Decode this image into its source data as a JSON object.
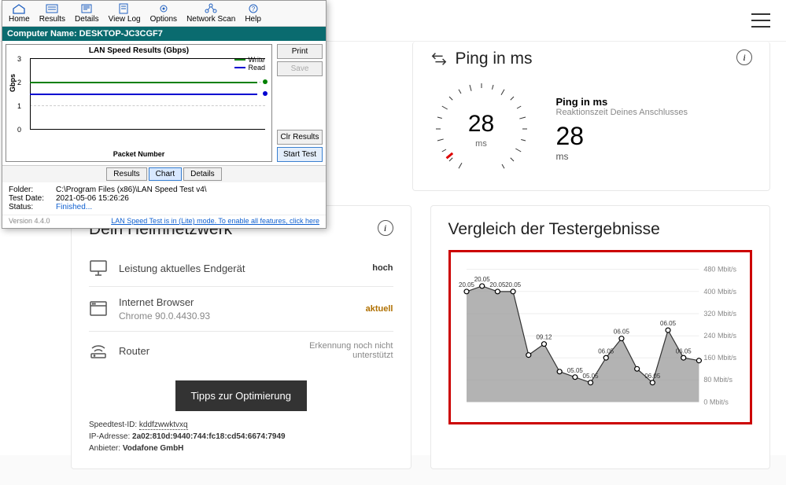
{
  "lan": {
    "menu": {
      "home": "Home",
      "results": "Results",
      "details": "Details",
      "viewlog": "View Log",
      "options": "Options",
      "netscan": "Network Scan",
      "help": "Help"
    },
    "titlebar": "Computer Name: DESKTOP-JC3CGF7",
    "chart": {
      "title": "LAN Speed Results (Gbps)",
      "ylabel": "Gbps",
      "xlabel": "Packet Number",
      "yticks": [
        "0",
        "1",
        "2",
        "3"
      ],
      "legend": {
        "write": "Write",
        "read": "Read"
      }
    },
    "buttons": {
      "print": "Print",
      "save": "Save",
      "clr": "Clr Results",
      "start": "Start Test"
    },
    "tabs": {
      "results": "Results",
      "chart": "Chart",
      "details": "Details"
    },
    "info": {
      "folder_k": "Folder:",
      "folder_v": "C:\\Program Files (x86)\\LAN Speed Test v4\\",
      "date_k": "Test Date:",
      "date_v": "2021-05-06 15:26:26",
      "status_k": "Status:",
      "status_v": "Finished..."
    },
    "footer": {
      "ver": "Version 4.4.0",
      "link": "LAN Speed Test is in (Lite) mode.  To enable all features, click here"
    }
  },
  "ping": {
    "title": "Ping in ms",
    "gauge_value": "28",
    "gauge_unit": "ms",
    "label1": "Ping in ms",
    "label2": "Reaktionszeit Deines Anschlusses",
    "big": "28",
    "big_unit": "ms"
  },
  "home": {
    "title": "Dein Heimnetzwerk",
    "row1_label": "Leistung aktuelles Endgerät",
    "row1_val": "hoch",
    "row2_label": "Internet Browser",
    "row2_sub": "Chrome 90.0.4430.93",
    "row2_val": "aktuell",
    "row3_label": "Router",
    "row3_val": "Erkennung noch nicht\nunterstützt",
    "opt_btn": "Tipps zur Optimierung",
    "meta_id_k": "Speedtest-ID: ",
    "meta_id_v": "kddfzwwktvxq",
    "meta_ip_k": "IP-Adresse: ",
    "meta_ip_v": "2a02:810d:9440:744:fc18:cd54:6674:7949",
    "meta_anb_k": "Anbieter: ",
    "meta_anb_v": "Vodafone GmbH"
  },
  "compare": {
    "title": "Vergleich der Testergebnisse",
    "y_ticks": [
      "0 Mbit/s",
      "80 Mbit/s",
      "160 Mbit/s",
      "240 Mbit/s",
      "320 Mbit/s",
      "400 Mbit/s",
      "480 Mbit/s"
    ]
  },
  "chart_data": [
    {
      "type": "line",
      "title": "LAN Speed Results (Gbps)",
      "xlabel": "Packet Number",
      "ylabel": "Gbps",
      "ylim": [
        0,
        3
      ],
      "series": [
        {
          "name": "Write",
          "color": "#008000",
          "values": [
            2.0,
            2.0
          ]
        },
        {
          "name": "Read",
          "color": "#0000d0",
          "values": [
            1.5,
            1.5
          ]
        }
      ]
    },
    {
      "type": "area",
      "title": "Vergleich der Testergebnisse",
      "ylabel": "Mbit/s",
      "ylim": [
        0,
        480
      ],
      "y_ticks": [
        0,
        80,
        160,
        240,
        320,
        400,
        480
      ],
      "points": [
        {
          "label": "20.05",
          "value": 400
        },
        {
          "label": "20.05",
          "value": 420
        },
        {
          "label": "20.05",
          "value": 400
        },
        {
          "label": "20.05",
          "value": 400
        },
        {
          "label": "",
          "value": 170
        },
        {
          "label": "09.12",
          "value": 210
        },
        {
          "label": "",
          "value": 110
        },
        {
          "label": "05.05",
          "value": 90
        },
        {
          "label": "05.05",
          "value": 70
        },
        {
          "label": "06.05",
          "value": 160
        },
        {
          "label": "06.05",
          "value": 230
        },
        {
          "label": "",
          "value": 120
        },
        {
          "label": "06.05",
          "value": 70
        },
        {
          "label": "06.05",
          "value": 260
        },
        {
          "label": "06.05",
          "value": 160
        },
        {
          "label": "",
          "value": 150
        }
      ]
    }
  ]
}
